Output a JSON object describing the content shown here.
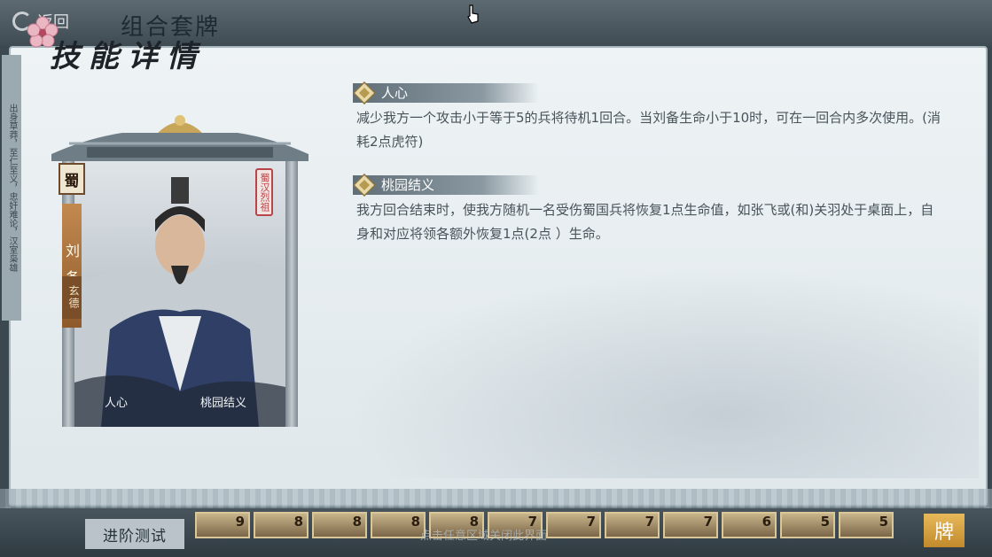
{
  "topbar": {
    "back_label": "返回",
    "title": "组合套牌"
  },
  "heading": {
    "title": "技能详情"
  },
  "side_banner": {
    "text": "出身草莽，至仁至义，忠奸难论，汉室枭雄"
  },
  "hero": {
    "faction": "蜀",
    "name": "刘备",
    "courtesy_name": "玄德",
    "title_seal": "蜀汉烈祖",
    "card_skills": [
      "人心",
      "桃园结义"
    ]
  },
  "skills": [
    {
      "name": "人心",
      "icon": "diamond-emblem-icon",
      "description": "减少我方一个攻击小于等于5的兵将待机1回合。当刘备生命小于10时，可在一回合内多次使用。(消耗2点虎符)"
    },
    {
      "name": "桃园结义",
      "icon": "diamond-emblem-icon",
      "description": "我方回合结束时，使我方随机一名受伤蜀国兵将恢复1点生命值，如张飞或(和)关羽处于桌面上，自身和对应将领各额外恢复1点(2点 ）生命。"
    }
  ],
  "bottombar": {
    "advanced_test_label": "进阶测试",
    "close_hint": "点击任意区域关闭此界面",
    "card_costs": [
      "9",
      "8",
      "8",
      "8",
      "8",
      "7",
      "7",
      "7",
      "7",
      "6",
      "5",
      "5"
    ],
    "deck_button_label": "牌"
  },
  "colors": {
    "panel_bg": "#eef3f5",
    "skill_bar": "#5f6e77",
    "text": "#48535a",
    "gold": "#e8b95a"
  }
}
